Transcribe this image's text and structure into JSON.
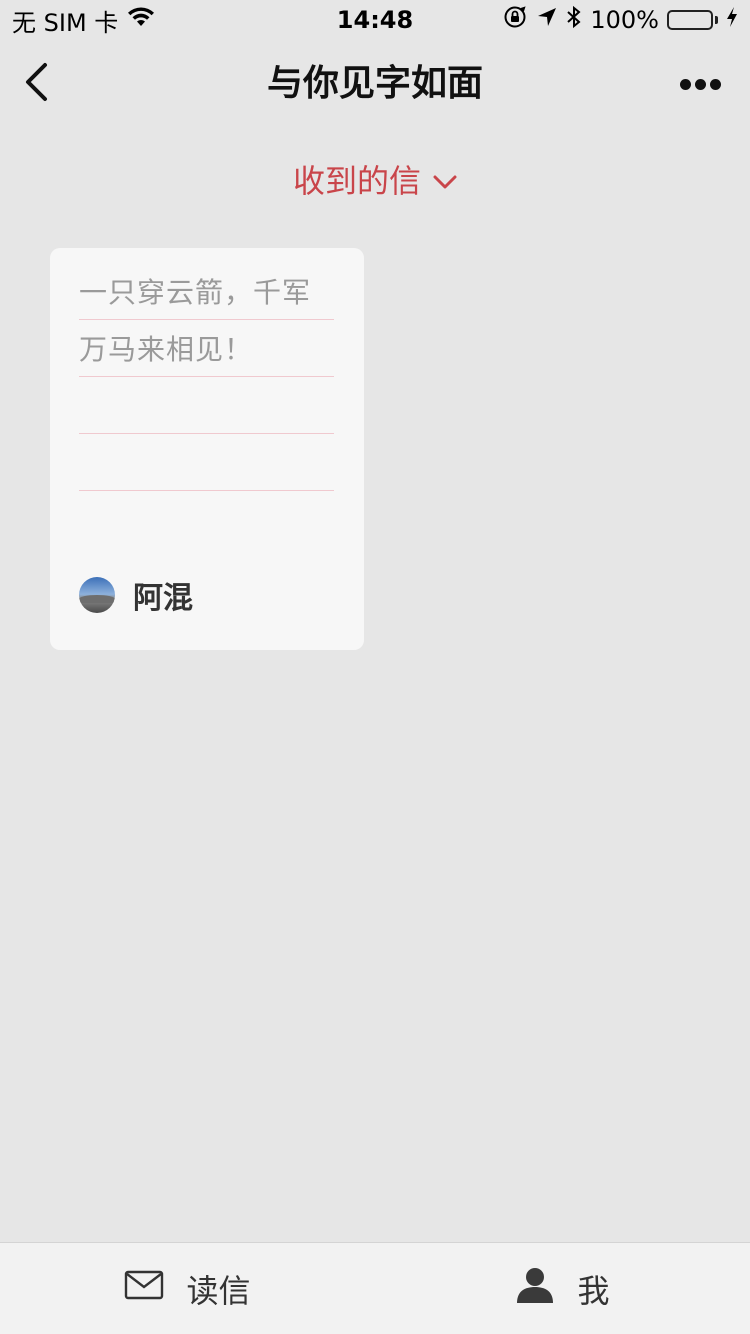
{
  "status_bar": {
    "carrier": "无 SIM 卡",
    "time": "14:48",
    "battery_percent": "100%",
    "battery_level": 1.0,
    "icons": [
      "wifi-icon",
      "orientation-lock-icon",
      "location-arrow-icon",
      "bluetooth-icon",
      "battery-icon",
      "charging-bolt-icon"
    ]
  },
  "nav": {
    "title": "与你见字如面",
    "back_icon": "chevron-left-icon",
    "more_icon": "more-dots-icon"
  },
  "filter": {
    "label": "收到的信",
    "icon": "chevron-down-icon",
    "color": "#c9454a"
  },
  "letters": [
    {
      "lines": [
        "一只穿云箭，千军",
        "万马来相见！",
        "",
        ""
      ],
      "sender": "阿混",
      "avatar": "avatar"
    }
  ],
  "tab_bar": {
    "tabs": [
      {
        "label": "读信",
        "icon": "envelope-icon"
      },
      {
        "label": "我",
        "icon": "person-icon"
      }
    ]
  }
}
